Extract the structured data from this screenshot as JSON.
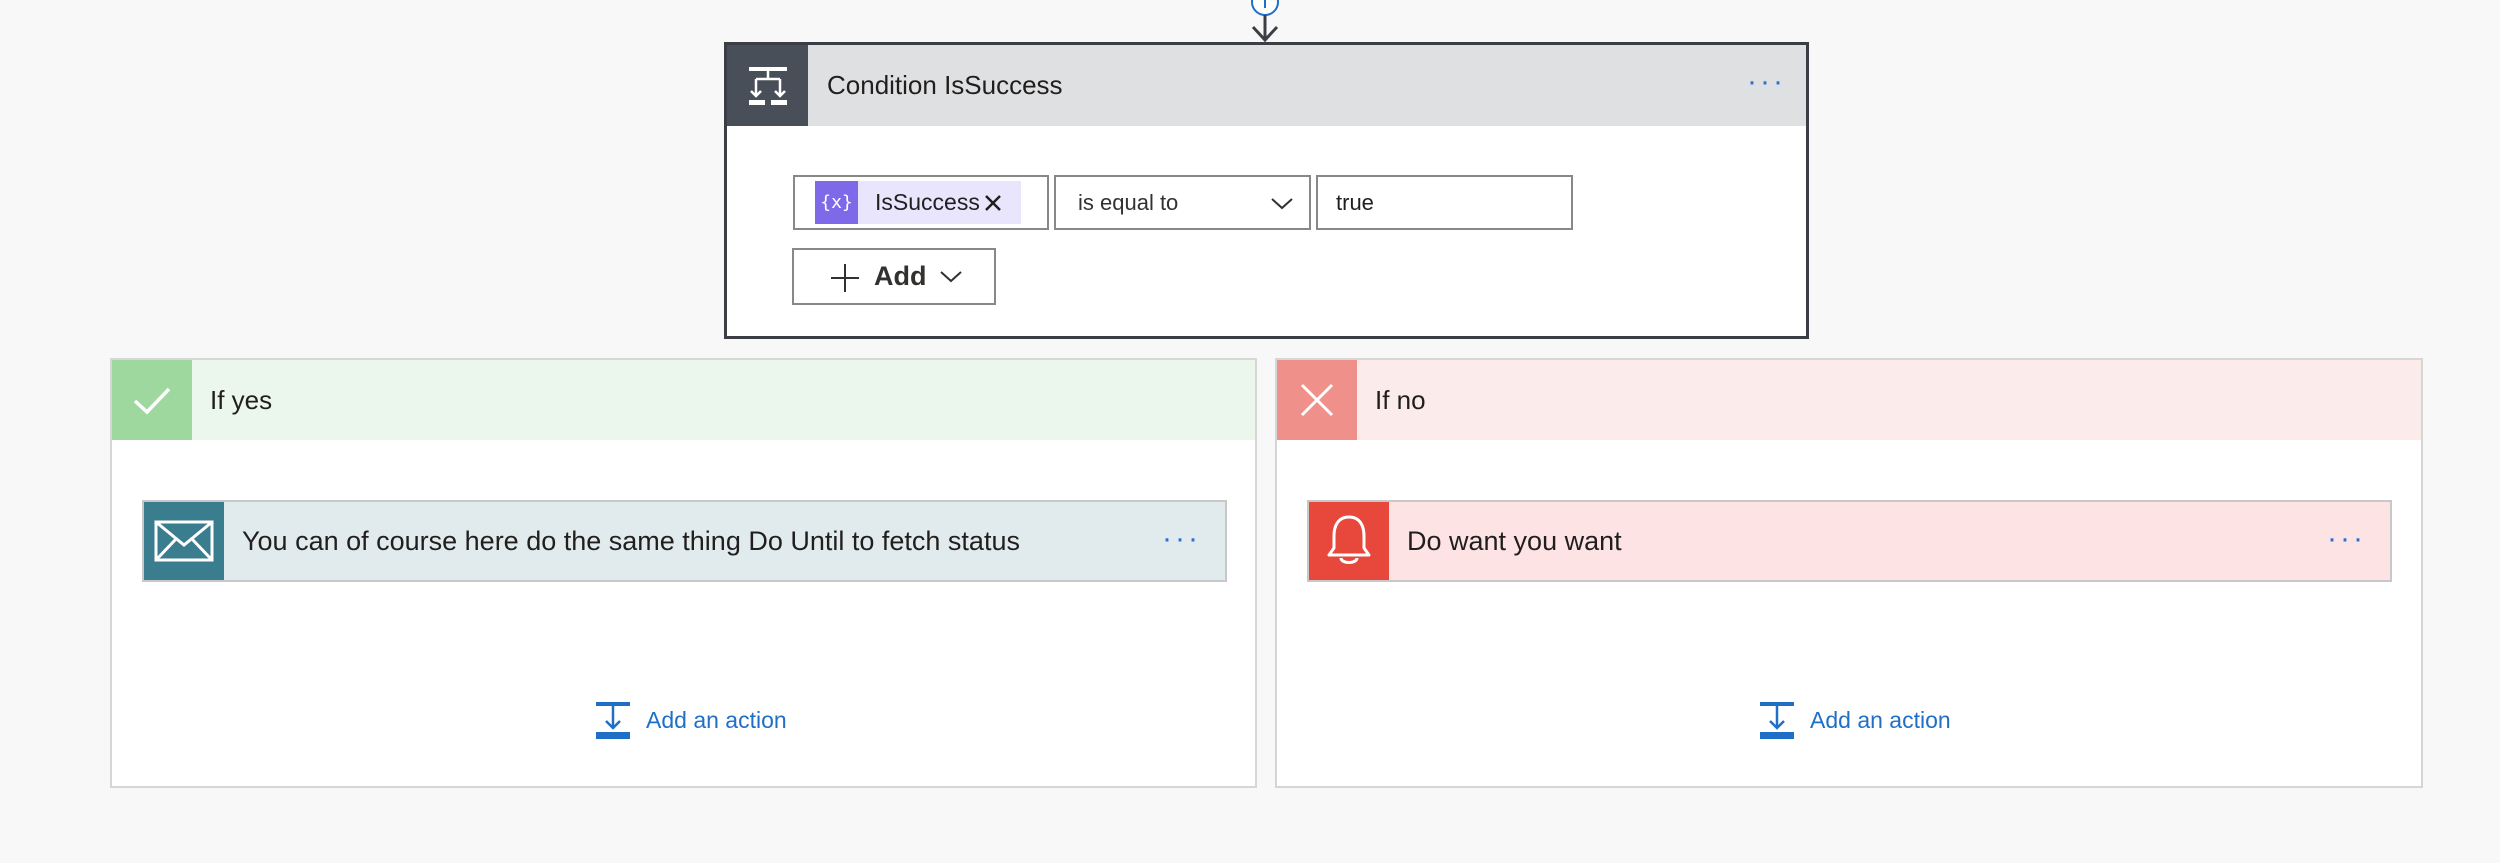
{
  "condition": {
    "title": "Condition IsSuccess",
    "more_label": "···",
    "token_label": "IsSuccess",
    "token_icon": "{x}",
    "operator": "is equal to",
    "value": "true",
    "add_label": "Add"
  },
  "yes_branch": {
    "label": "If yes",
    "action_title": "You can of course here do the same thing Do Until to fetch status",
    "action_more": "···",
    "add_action_label": "Add an action"
  },
  "no_branch": {
    "label": "If no",
    "action_title": "Do want you want",
    "action_more": "···",
    "add_action_label": "Add an action"
  },
  "icons": {
    "condition": "condition-icon",
    "variable": "variable-icon",
    "success": "check-icon",
    "failure": "x-icon",
    "email": "mail-icon",
    "notification": "bell-icon",
    "add_action": "add-action-icon"
  },
  "colors": {
    "condition_header": "#dfe0e2",
    "condition_icon_bg": "#484f58",
    "token_bg": "#e8e5fc",
    "token_icon_bg": "#7e69e8",
    "yes_header": "#ebf7ec",
    "yes_icon_bg": "#9fd89f",
    "no_header": "#fcebeb",
    "no_icon_bg": "#f0908a",
    "mail_card_bg": "#e1ebed",
    "mail_icon_bg": "#3a7d8f",
    "bell_card_bg": "#fde3e3",
    "bell_icon_bg": "#e8473b",
    "link": "#1f6fc7"
  }
}
